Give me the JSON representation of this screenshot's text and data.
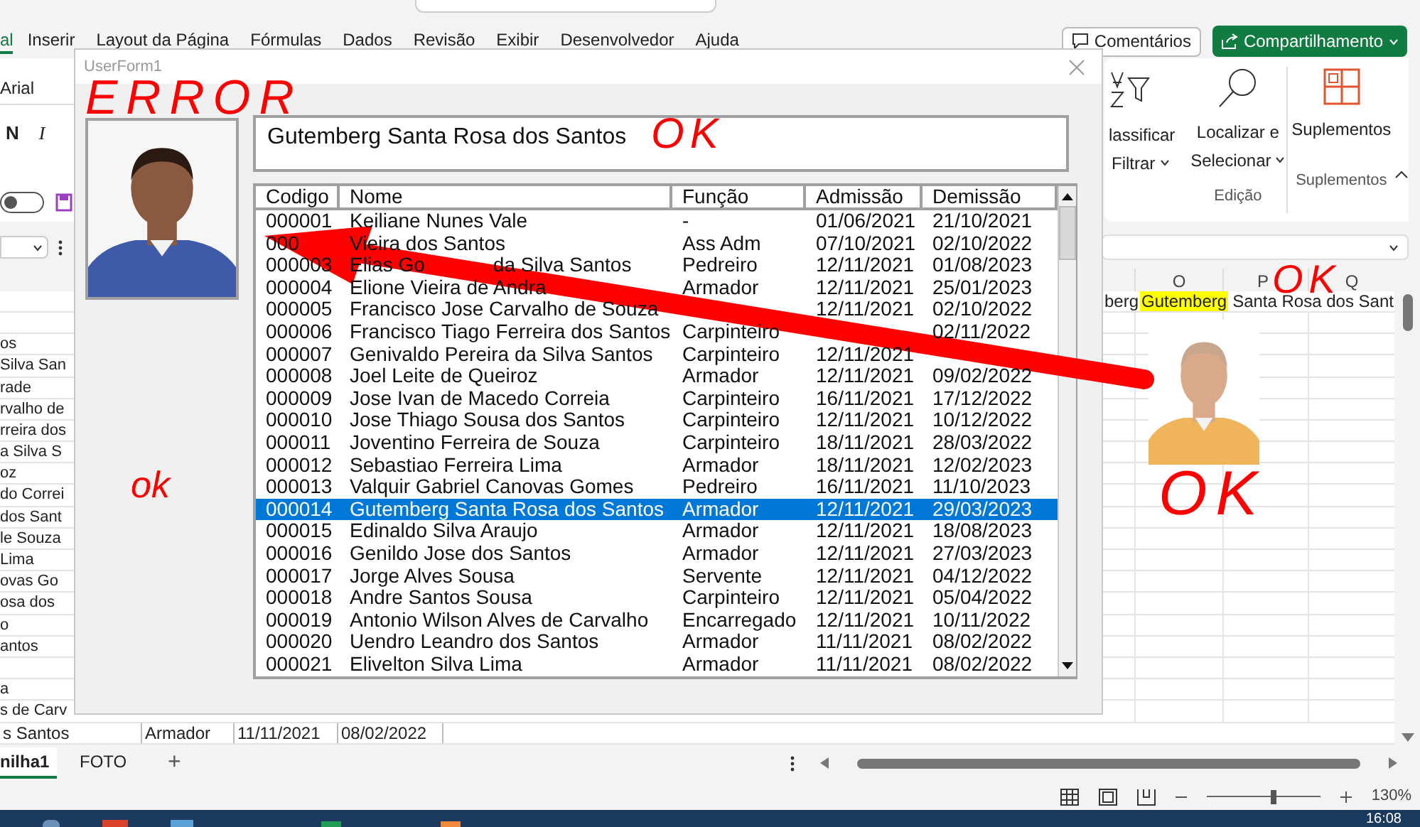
{
  "excel": {
    "tabs": [
      {
        "label": "al",
        "selected": true
      },
      {
        "label": "Inserir",
        "selected": false
      },
      {
        "label": "Layout da Página",
        "selected": false
      },
      {
        "label": "Fórmulas",
        "selected": false
      },
      {
        "label": "Dados",
        "selected": false
      },
      {
        "label": "Revisão",
        "selected": false
      },
      {
        "label": "Exibir",
        "selected": false
      },
      {
        "label": "Desenvolvedor",
        "selected": false
      },
      {
        "label": "Ajuda",
        "selected": false
      }
    ],
    "comments_button": "Comentários",
    "share_button": "Compartilhamento",
    "ribbon": {
      "font": "Arial",
      "bold": "N",
      "italic": "I",
      "toggle": {
        "on": false
      },
      "sort_filter": [
        "lassificar",
        "Filtrar"
      ],
      "find_select": [
        "Localizar e",
        "Selecionar"
      ],
      "edit_group": "Edição",
      "addins_button": "Suplementos",
      "addins_group": "Suplementos"
    },
    "column_headers": [
      "O",
      "P",
      "Q"
    ],
    "right_cells": [
      {
        "text": "berg",
        "highlighted": false
      },
      {
        "text": "Gutemberg",
        "highlighted": true
      },
      {
        "text": "Santa Rosa dos Sant",
        "highlighted": false
      }
    ],
    "left_cells": [
      {
        "text": "os"
      },
      {
        "text": "Silva San"
      },
      {
        "text": "rade"
      },
      {
        "text": "rvalho de"
      },
      {
        "text": "rreira dos"
      },
      {
        "text": "a Silva S"
      },
      {
        "text": "oz"
      },
      {
        "text": "do Correi"
      },
      {
        "text": "dos Sant"
      },
      {
        "text": "le Souza"
      },
      {
        "text": "Lima"
      },
      {
        "text": "ovas Go"
      },
      {
        "text": "osa dos"
      },
      {
        "text": "o"
      },
      {
        "text": "antos"
      },
      {},
      {
        "text": "a"
      },
      {
        "text": "s de Carv"
      }
    ],
    "bottom_row": [
      "s Santos",
      "Armador",
      "11/11/2021",
      "08/02/2022"
    ],
    "photo": {
      "kind": "picture"
    },
    "sheet_tabs": [
      {
        "label": "nilha1",
        "selected": true
      },
      {
        "label": "FOTO",
        "selected": false
      }
    ],
    "add_sheet": "+",
    "zoom": {
      "level": 0.6,
      "reading": "130%"
    },
    "clock": "16:08"
  },
  "form": {
    "title": "UserForm1",
    "photo": {
      "kind": "picture"
    },
    "name": "Gutemberg Santa Rosa dos Santos",
    "columns": [
      "Codigo",
      "Nome",
      "Função",
      "Admissão",
      "Demissão"
    ],
    "rows": [
      {
        "code": "000001",
        "name": [
          "Keiliane Nunes Vale"
        ],
        "role": "-",
        "admission": "01/06/2021",
        "dismissal": "21/10/2021",
        "selected": false
      },
      {
        "code": "000",
        "name": [
          "Vieira dos Santos"
        ],
        "role": "Ass Adm",
        "admission": "07/10/2021",
        "dismissal": "02/10/2022",
        "selected": false
      },
      {
        "code": "000003",
        "name": [
          "Elias Go",
          "da Silva Santos"
        ],
        "role": "Pedreiro",
        "admission": "12/11/2021",
        "dismissal": "01/08/2023",
        "selected": false
      },
      {
        "code": "000004",
        "name": [
          "Elione Vieira de Andra"
        ],
        "role": "Armador",
        "admission": "12/11/2021",
        "dismissal": "25/01/2023",
        "selected": false
      },
      {
        "code": "000005",
        "name": [
          "Francisco Jose Carvalho de Souza"
        ],
        "admission": "12/11/2021",
        "dismissal": "02/10/2022",
        "selected": false
      },
      {
        "code": "000006",
        "name": [
          "Francisco Tiago Ferreira dos Santos"
        ],
        "role": "Carpinteiro",
        "dismissal": "02/11/2022",
        "selected": false
      },
      {
        "code": "000007",
        "name": [
          "Genivaldo Pereira da Silva Santos"
        ],
        "role": "Carpinteiro",
        "admission": "12/11/2021",
        "selected": false
      },
      {
        "code": "000008",
        "name": [
          "Joel Leite de Queiroz"
        ],
        "role": "Armador",
        "admission": "12/11/2021",
        "dismissal": "09/02/2022",
        "selected": false
      },
      {
        "code": "000009",
        "name": [
          "Jose Ivan de Macedo Correia"
        ],
        "role": "Carpinteiro",
        "admission": "16/11/2021",
        "dismissal": "17/12/2022",
        "selected": false
      },
      {
        "code": "000010",
        "name": [
          "Jose Thiago Sousa dos Santos"
        ],
        "role": "Carpinteiro",
        "admission": "12/11/2021",
        "dismissal": "10/12/2022",
        "selected": false
      },
      {
        "code": "000011",
        "name": [
          "Joventino Ferreira de Souza"
        ],
        "role": "Carpinteiro",
        "admission": "18/11/2021",
        "dismissal": "28/03/2022",
        "selected": false
      },
      {
        "code": "000012",
        "name": [
          "Sebastiao Ferreira Lima"
        ],
        "role": "Armador",
        "admission": "18/11/2021",
        "dismissal": "12/02/2023",
        "selected": false
      },
      {
        "code": "000013",
        "name": [
          "Valquir Gabriel Canovas Gomes"
        ],
        "role": "Pedreiro",
        "admission": "16/11/2021",
        "dismissal": "11/10/2023",
        "selected": false
      },
      {
        "code": "000014",
        "name": [
          "Gutemberg Santa Rosa dos Santos"
        ],
        "role": "Armador",
        "admission": "12/11/2021",
        "dismissal": "29/03/2023",
        "selected": true
      },
      {
        "code": "000015",
        "name": [
          "Edinaldo Silva Araujo"
        ],
        "role": "Armador",
        "admission": "12/11/2021",
        "dismissal": "18/08/2023",
        "selected": false
      },
      {
        "code": "000016",
        "name": [
          "Genildo Jose dos Santos"
        ],
        "role": "Armador",
        "admission": "12/11/2021",
        "dismissal": "27/03/2023",
        "selected": false
      },
      {
        "code": "000017",
        "name": [
          "Jorge Alves Sousa"
        ],
        "role": "Servente",
        "admission": "12/11/2021",
        "dismissal": "04/12/2022",
        "selected": false
      },
      {
        "code": "000018",
        "name": [
          "Andre Santos Sousa"
        ],
        "role": "Carpinteiro",
        "admission": "12/11/2021",
        "dismissal": "05/04/2022",
        "selected": false
      },
      {
        "code": "000019",
        "name": [
          "Antonio Wilson Alves de Carvalho"
        ],
        "role": "Encarregado",
        "admission": "12/11/2021",
        "dismissal": "10/11/2022",
        "selected": false
      },
      {
        "code": "000020",
        "name": [
          "Uendro Leandro dos Santos"
        ],
        "role": "Armador",
        "admission": "11/11/2021",
        "dismissal": "08/02/2022",
        "selected": false
      },
      {
        "code": "000021",
        "name": [
          "Elivelton Silva Lima"
        ],
        "role": "Armador",
        "admission": "11/11/2021",
        "dismissal": "08/02/2022",
        "selected": false
      }
    ]
  },
  "annotations": [
    {
      "text": "ERROR"
    },
    {
      "text": "OK"
    },
    {
      "text": "ok"
    },
    {
      "text": "OK"
    },
    {
      "text": "OK"
    }
  ]
}
